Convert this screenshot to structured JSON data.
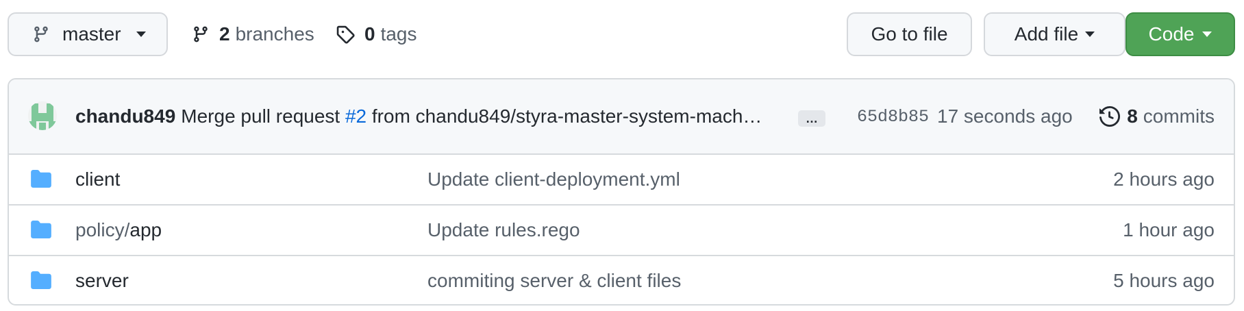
{
  "toolbar": {
    "branch_label": "master",
    "branches_count": "2",
    "branches_label": "branches",
    "tags_count": "0",
    "tags_label": "tags",
    "goto_file_label": "Go to file",
    "add_file_label": "Add file",
    "code_label": "Code"
  },
  "commit": {
    "author": "chandu849",
    "message_prefix": "Merge pull request",
    "pr_ref": "#2",
    "message_suffix": "from chandu849/styra-master-system-mach…",
    "ellipsis": "…",
    "sha": "65d8b85",
    "time_ago": "17 seconds ago",
    "commits_count": "8",
    "commits_label": "commits"
  },
  "files": [
    {
      "name_dim": "",
      "name": "client",
      "message": "Update client-deployment.yml",
      "time": "2 hours ago",
      "icon": "folder-icon"
    },
    {
      "name_dim": "policy/",
      "name": "app",
      "message": "Update rules.rego",
      "time": "1 hour ago",
      "icon": "folder-icon"
    },
    {
      "name_dim": "",
      "name": "server",
      "message": "commiting server & client files",
      "time": "5 hours ago",
      "icon": "folder-icon"
    }
  ],
  "colors": {
    "accent_green": "#4fa356",
    "link_blue": "#0969da",
    "folder_blue": "#54aeff"
  }
}
